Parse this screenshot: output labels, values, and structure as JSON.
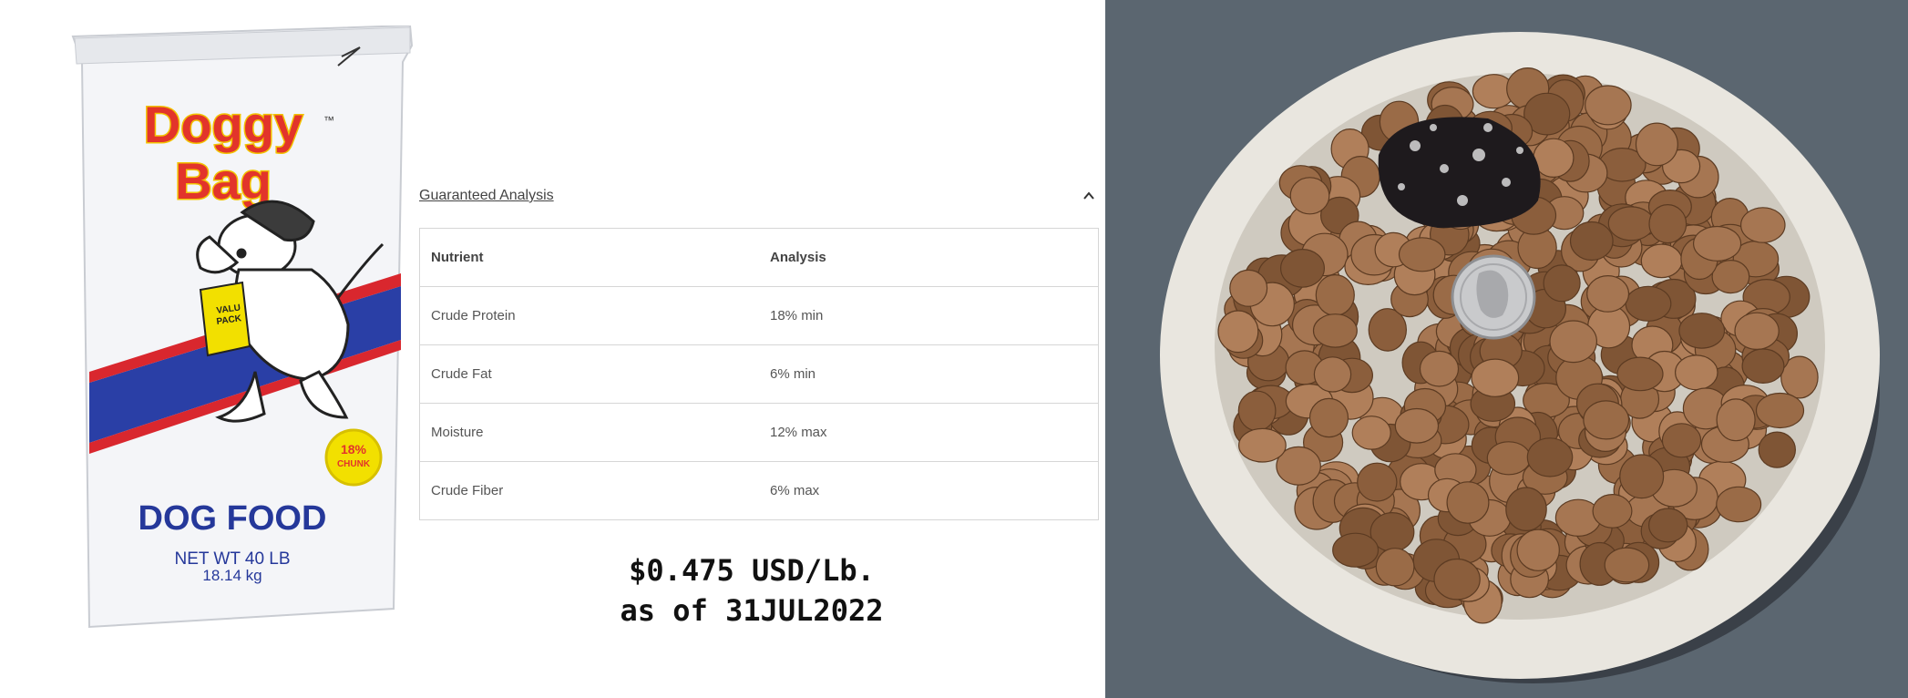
{
  "product": {
    "brand_line1": "Doggy",
    "brand_line2": "Bag",
    "trademark": "™",
    "pack_label_line1": "VALU",
    "pack_label_line2": "PACK",
    "badge_line1": "18%",
    "badge_line2": "CHUNK",
    "category": "DOG FOOD",
    "net_weight": "NET WT 40 LB",
    "net_weight_metric": "18.14 kg",
    "colors": {
      "brand_red": "#e2342b",
      "brand_yellow": "#f2c200",
      "stripe_blue": "#2a3fa6",
      "stripe_red": "#d9272e",
      "text_blue": "#25389a"
    }
  },
  "analysis": {
    "title": "Guaranteed Analysis",
    "toggle_icon": "chevron-up-icon",
    "columns": [
      "Nutrient",
      "Analysis"
    ],
    "rows": [
      [
        "Crude Protein",
        "18% min"
      ],
      [
        "Crude Fat",
        "6% min"
      ],
      [
        "Moisture",
        "12% max"
      ],
      [
        "Crude Fiber",
        "6% max"
      ]
    ]
  },
  "price": {
    "line1": "$0.475 USD/Lb.",
    "line2": "as of 31JUL2022"
  },
  "photo": {
    "subject": "kibble-bowl-photo",
    "colors": {
      "background": "#5b6670",
      "bowl": "#e9e6df",
      "kibble": "#9a6b47",
      "stone": "#1e1a1d",
      "coin": "#c9cacc"
    }
  }
}
